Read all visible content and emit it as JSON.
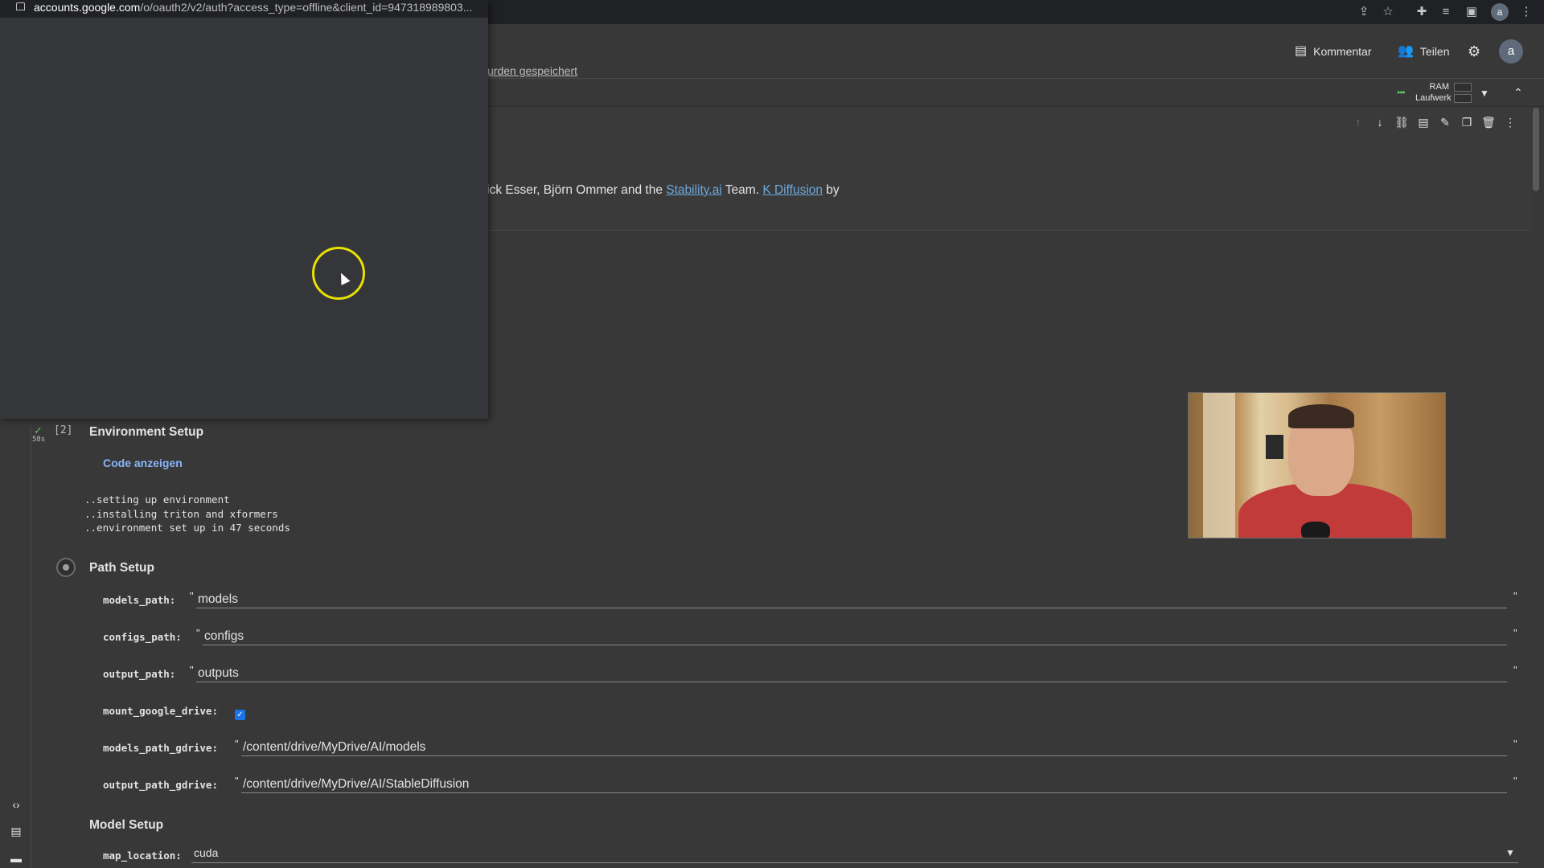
{
  "browser": {
    "popup_url_host": "accounts.google.com",
    "popup_url_path": "/o/oauth2/v2/auth?access_type=offline&client_id=947318989803..."
  },
  "header": {
    "comment_label": "Kommentar",
    "share_label": "Teilen",
    "saved_text": "urden gespeichert",
    "avatar_letter": "a"
  },
  "resources": {
    "ram_label": "RAM",
    "disk_label": "Laufwerk"
  },
  "text_cell": {
    "credits_prefix": "rick Esser, Björn Ommer and the ",
    "link1": "Stability.ai",
    "credits_mid": " Team. ",
    "link2": "K Diffusion",
    "credits_suffix": " by"
  },
  "environment_cell": {
    "exec_count": "[2]",
    "run_time": "58s",
    "title": "Environment Setup",
    "show_code": "Code anzeigen",
    "output": "..setting up environment\n..installing triton and xformers\n..environment set up in 47 seconds"
  },
  "path_setup": {
    "title": "Path Setup",
    "fields": [
      {
        "label": "models_path:",
        "value": "models"
      },
      {
        "label": "configs_path:",
        "value": "configs"
      },
      {
        "label": "output_path:",
        "value": "outputs"
      },
      {
        "label": "mount_google_drive:",
        "checked": true
      },
      {
        "label": "models_path_gdrive:",
        "value": "/content/drive/MyDrive/AI/models"
      },
      {
        "label": "output_path_gdrive:",
        "value": "/content/drive/MyDrive/AI/StableDiffusion"
      }
    ]
  },
  "model_setup": {
    "title": "Model Setup",
    "map_location_label": "map_location:",
    "map_location_value": "cuda"
  },
  "colors": {
    "background": "#383838",
    "link": "#8ab4f8",
    "checkbox": "#1a73e8",
    "cursor_ring": "#e8e000"
  }
}
